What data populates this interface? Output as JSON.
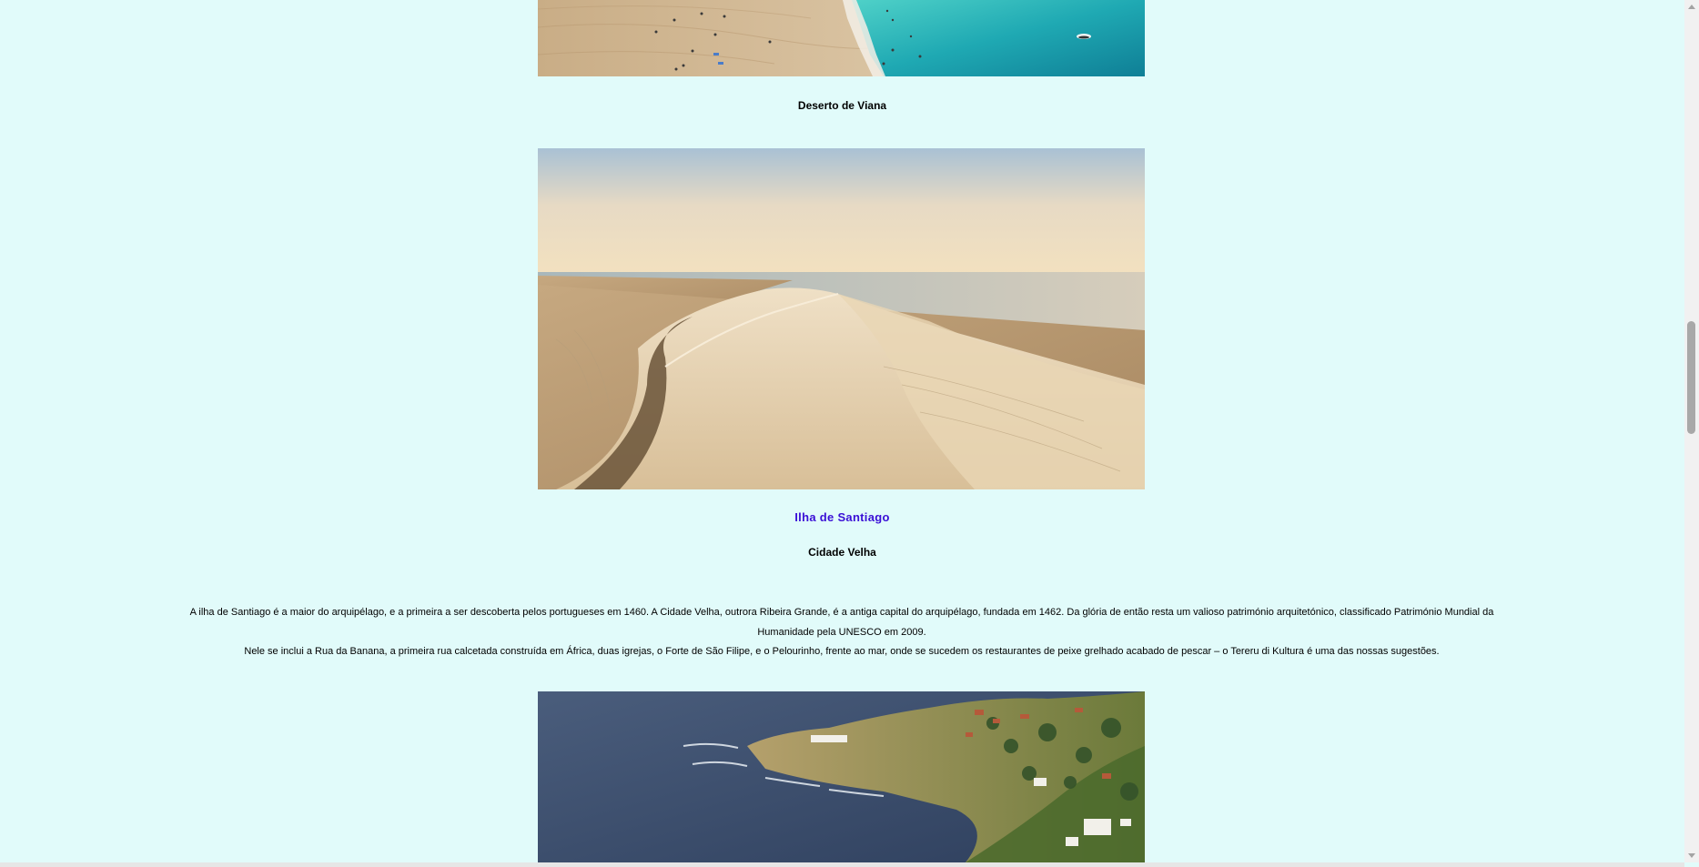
{
  "images": {
    "beach": "beach-aerial-photo",
    "dune": "sand-dune-photo",
    "coast": "coastline-aerial-photo"
  },
  "captions": {
    "viana": "Deserto de Viana",
    "cidade_velha": "Cidade Velha"
  },
  "island_heading": "Ilha de Santiago",
  "paragraph": {
    "line1": "A ilha de Santiago é a maior do arquipélago, e a primeira a ser descoberta pelos portugueses em 1460. A Cidade Velha, outrora Ribeira Grande, é a antiga capital do arquipélago, fundada em 1462. Da glória de então resta um valioso património arquitetónico, classificado Património Mundial da Humanidade pela UNESCO em 2009.",
    "line2": "Nele se inclui a Rua da Banana, a primeira rua calcetada construída em África, duas igrejas, o Forte de São Filipe, e o Pelourinho, frente ao mar, onde se sucedem os restaurantes de peixe grelhado acabado de pescar – o Tereru di Kultura é uma das nossas sugestões."
  },
  "colors": {
    "background": "#e1fbfa",
    "link": "#3a0fd6"
  }
}
